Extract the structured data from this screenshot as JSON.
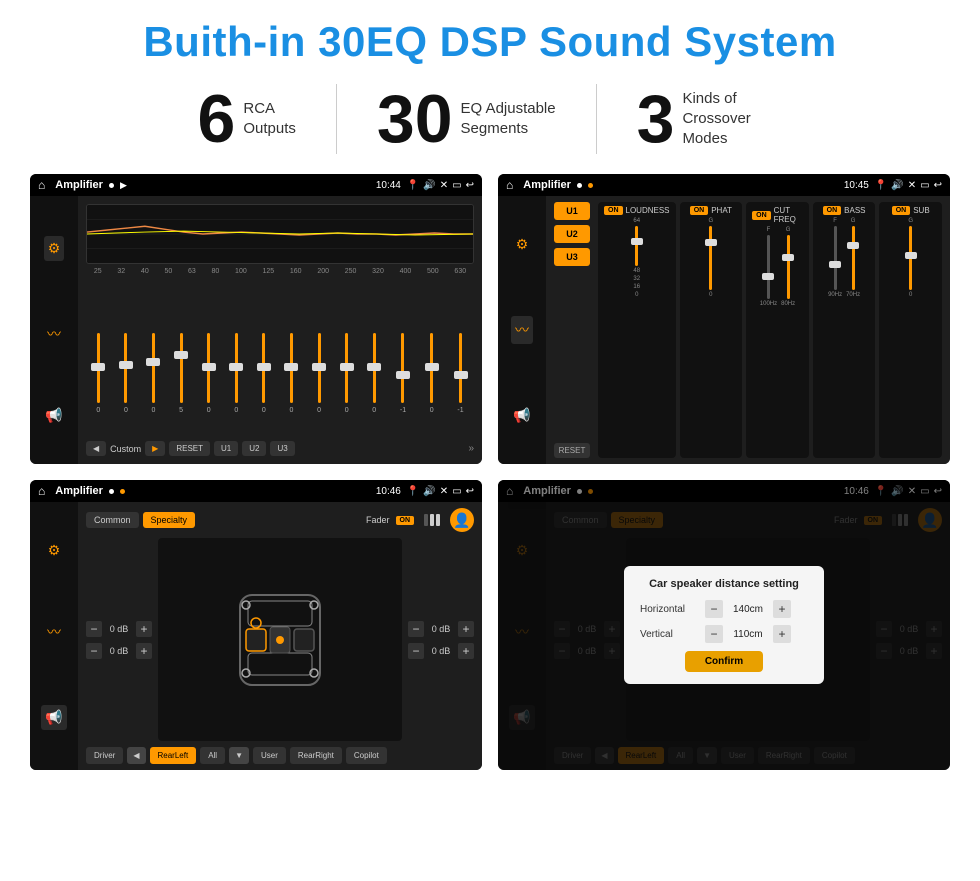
{
  "header": {
    "title": "Buith-in 30EQ DSP Sound System"
  },
  "features": [
    {
      "number": "6",
      "label_line1": "RCA",
      "label_line2": "Outputs"
    },
    {
      "number": "30",
      "label_line1": "EQ Adjustable",
      "label_line2": "Segments"
    },
    {
      "number": "3",
      "label_line1": "Kinds of",
      "label_line2": "Crossover Modes"
    }
  ],
  "screens": {
    "eq": {
      "app_name": "Amplifier",
      "time": "10:44",
      "eq_freqs": [
        "25",
        "32",
        "40",
        "50",
        "63",
        "80",
        "100",
        "125",
        "160",
        "200",
        "250",
        "320",
        "400",
        "500",
        "630"
      ],
      "eq_vals": [
        "0",
        "0",
        "0",
        "5",
        "0",
        "0",
        "0",
        "0",
        "0",
        "0",
        "0",
        "-1",
        "0",
        "-1"
      ],
      "preset": "Custom",
      "buttons": [
        "RESET",
        "U1",
        "U2",
        "U3"
      ]
    },
    "crossover": {
      "app_name": "Amplifier",
      "time": "10:45",
      "presets": [
        "U1",
        "U2",
        "U3"
      ],
      "channels": [
        "LOUDNESS",
        "PHAT",
        "CUT FREQ",
        "BASS",
        "SUB"
      ],
      "reset_label": "RESET"
    },
    "speaker": {
      "app_name": "Amplifier",
      "time": "10:46",
      "tabs": [
        "Common",
        "Specialty"
      ],
      "active_tab": "Specialty",
      "fader_label": "Fader",
      "on_label": "ON",
      "left_vols": [
        "0 dB",
        "0 dB"
      ],
      "right_vols": [
        "0 dB",
        "0 dB"
      ],
      "bottom_btns": [
        "Driver",
        "RearLeft",
        "All",
        "User",
        "RearRight",
        "Copilot"
      ]
    },
    "dialog": {
      "app_name": "Amplifier",
      "time": "10:46",
      "title": "Car speaker distance setting",
      "horizontal_label": "Horizontal",
      "horizontal_val": "140cm",
      "vertical_label": "Vertical",
      "vertical_val": "110cm",
      "confirm_label": "Confirm",
      "right_vols": [
        "0 dB",
        "0 dB"
      ]
    }
  }
}
